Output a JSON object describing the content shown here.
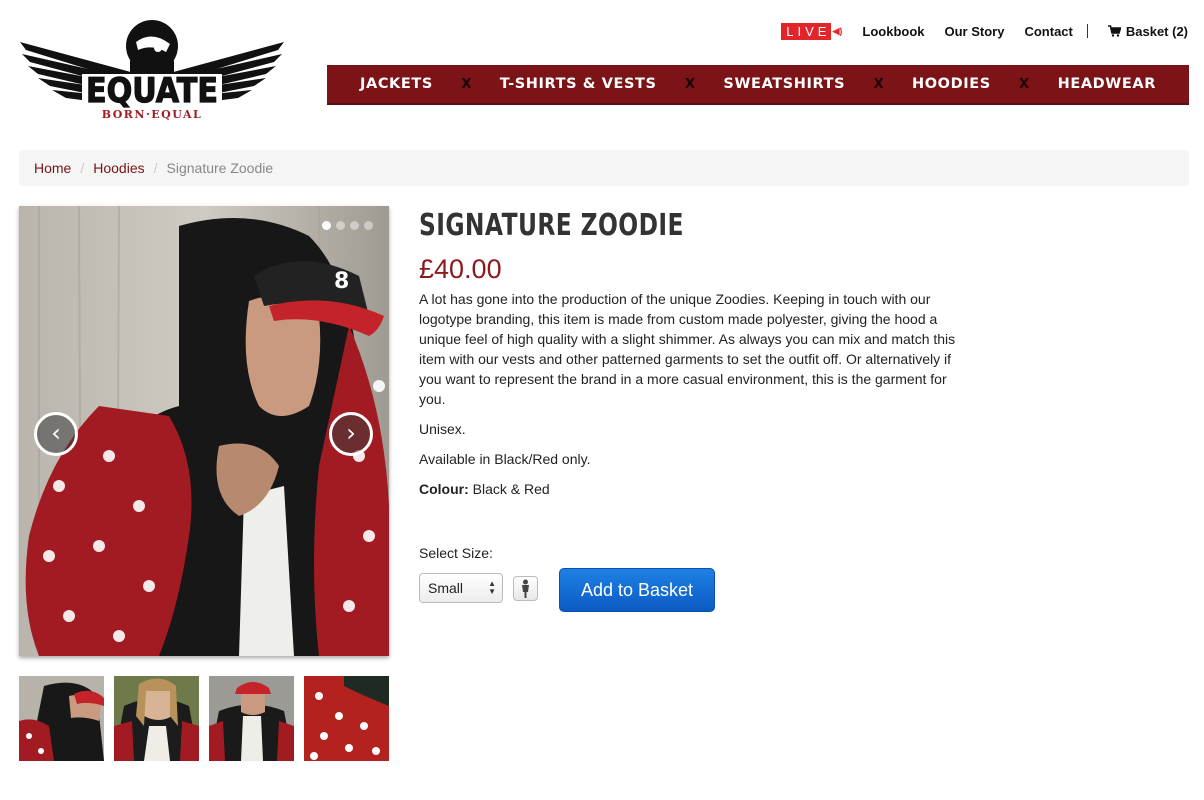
{
  "brand": {
    "logo_name": "EQUATE",
    "tagline": "BORN·EQUAL"
  },
  "top_links": {
    "live": "LIVE",
    "lookbook": "Lookbook",
    "our_story": "Our Story",
    "contact": "Contact",
    "basket": "Basket (2)"
  },
  "nav": {
    "items": [
      "JACKETS",
      "T-SHIRTS & VESTS",
      "SWEATSHIRTS",
      "HOODIES",
      "HEADWEAR"
    ],
    "separator": "X"
  },
  "breadcrumb": {
    "home": "Home",
    "category": "Hoodies",
    "current": "Signature Zoodie",
    "sep": "/"
  },
  "gallery": {
    "slide_count": 4,
    "active_slide": 1,
    "prev": "‹",
    "next": "›",
    "thumbnail_count": 4
  },
  "product": {
    "title": "SIGNATURE ZOODIE",
    "price": "£40.00",
    "description": "A lot has gone into the production of the unique Zoodies. Keeping in touch with our logotype branding, this item is made from custom made polyester, giving the hood a unique feel of high quality with a slight shimmer. As always you can mix and match this item with our vests and other patterned garments to set the outfit off. Or alternatively if you want to represent the brand in a more casual environment, this is the garment for you.",
    "unisex": "Unisex.",
    "availability": "Available in Black/Red only.",
    "colour_label": "Colour:",
    "colour_value": " Black & Red"
  },
  "purchase": {
    "size_label": "Select Size:",
    "size_selected": "Small",
    "add_label": "Add to Basket"
  },
  "colors": {
    "nav_bg": "#7c1316",
    "price": "#8b1a1e",
    "live_red": "#e4242b",
    "button_blue": "#0a5bc4"
  }
}
